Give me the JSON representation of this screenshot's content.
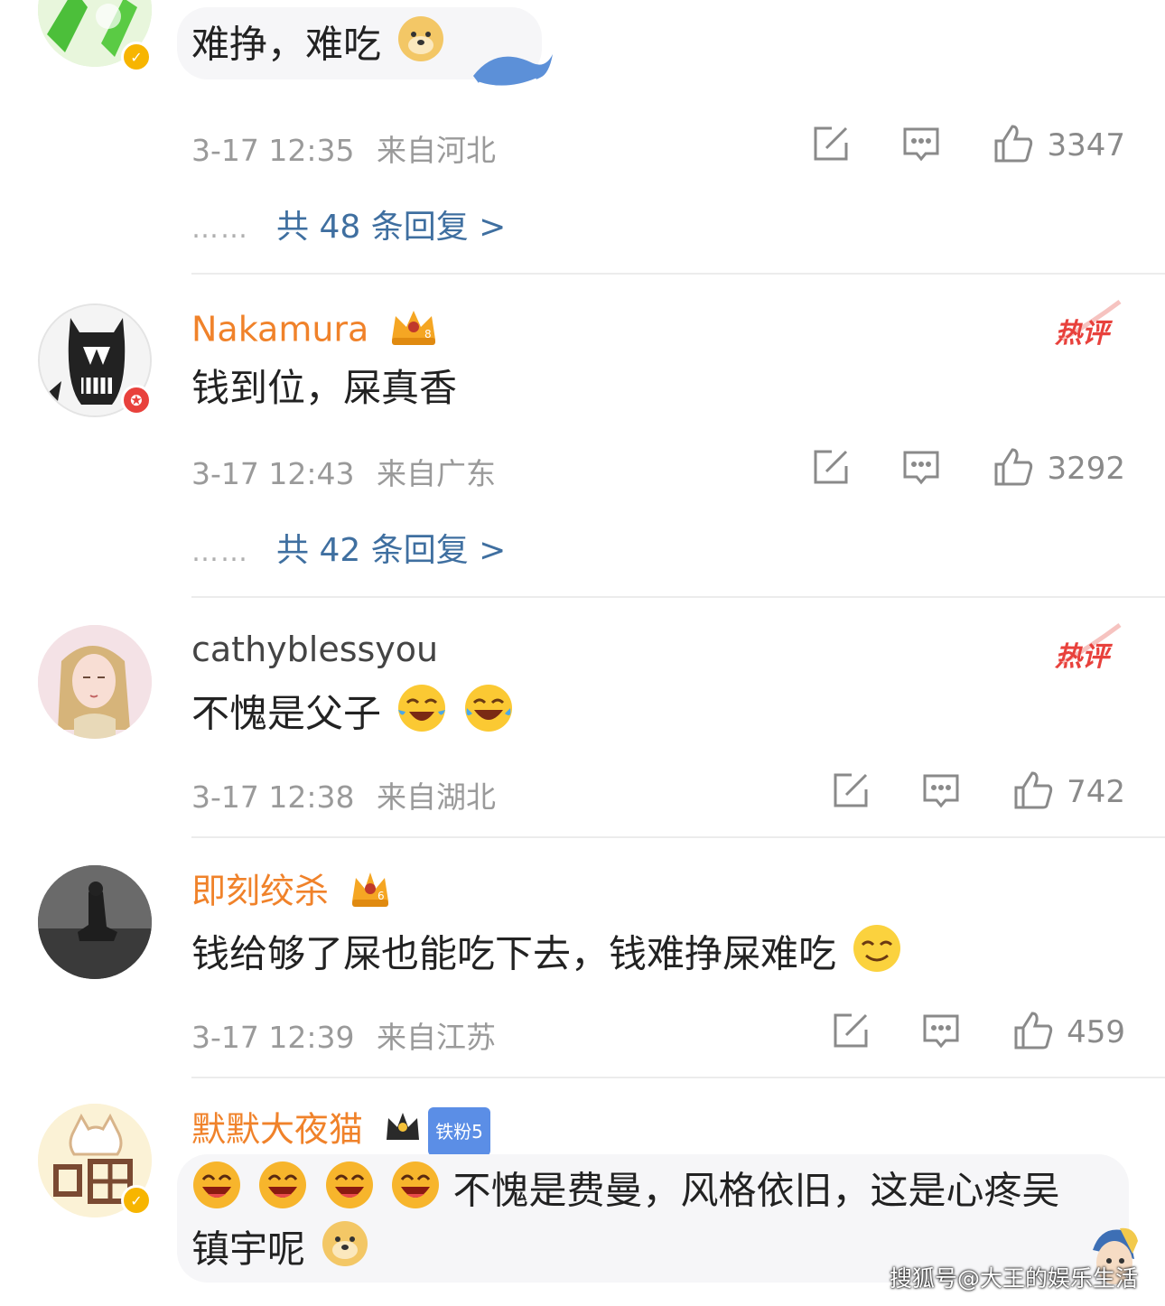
{
  "comments": [
    {
      "username": "",
      "text": "难挣，难吃",
      "time": "3-17 12:35",
      "location": "来自河北",
      "likes": "3347",
      "replies": "共 48 条回复 >",
      "hot": ""
    },
    {
      "username": "Nakamura",
      "text": "钱到位，屎真香",
      "time": "3-17 12:43",
      "location": "来自广东",
      "likes": "3292",
      "replies": "共 42 条回复 >",
      "hot": "热评"
    },
    {
      "username": "cathyblessyou",
      "text": "不愧是父子",
      "time": "3-17 12:38",
      "location": "来自湖北",
      "likes": "742",
      "hot": "热评"
    },
    {
      "username": "即刻绞杀",
      "text": "钱给够了屎也能吃下去，钱难挣屎难吃",
      "time": "3-17 12:39",
      "location": "来自江苏",
      "likes": "459"
    },
    {
      "username": "默默大夜猫",
      "fan_badge": "铁粉5",
      "text_line1": "不愧是费曼，风格依旧，这是心疼吴",
      "text_line2": "镇宇呢"
    }
  ],
  "reply_dots": "……",
  "watermark": "搜狐号@大王的娱乐生活",
  "colors": {
    "username_orange": "#f0822a",
    "reply_link": "#3f6fa0",
    "meta_gray": "#9a9a9a",
    "hot_red": "#e8413c"
  }
}
